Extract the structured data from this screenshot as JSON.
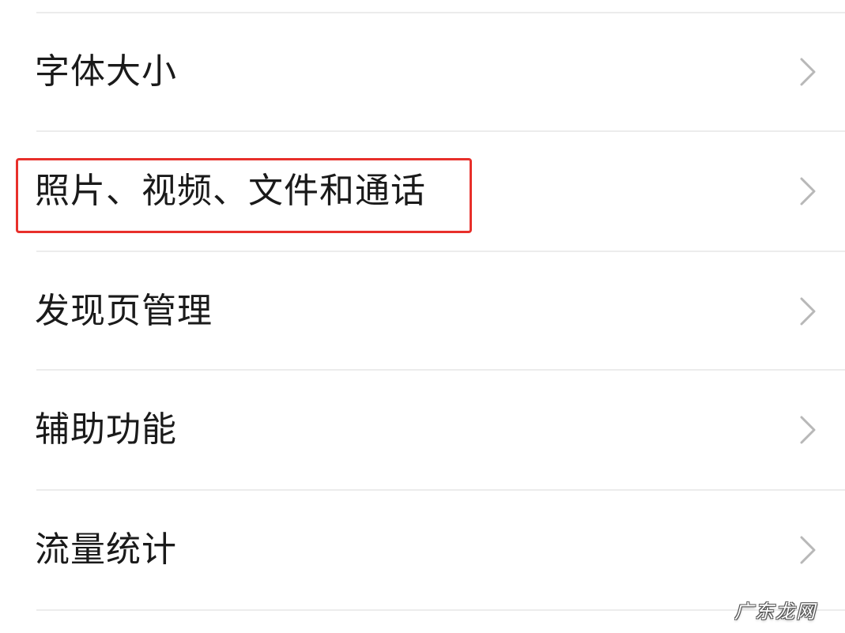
{
  "settings_list": {
    "items": [
      {
        "label": "字体大小",
        "icon": "chevron-right-icon"
      },
      {
        "label": "照片、视频、文件和通话",
        "icon": "chevron-right-icon"
      },
      {
        "label": "发现页管理",
        "icon": "chevron-right-icon"
      },
      {
        "label": "辅助功能",
        "icon": "chevron-right-icon"
      },
      {
        "label": "流量统计",
        "icon": "chevron-right-icon"
      }
    ]
  },
  "highlight": {
    "item": "照片、视频、文件和通话",
    "color": "#e8302b"
  },
  "watermark": {
    "text": "广东龙网"
  },
  "colors": {
    "text": "#1a1a1a",
    "chevron": "#b8b8b8",
    "divider": "#ececec",
    "background": "#ffffff"
  }
}
